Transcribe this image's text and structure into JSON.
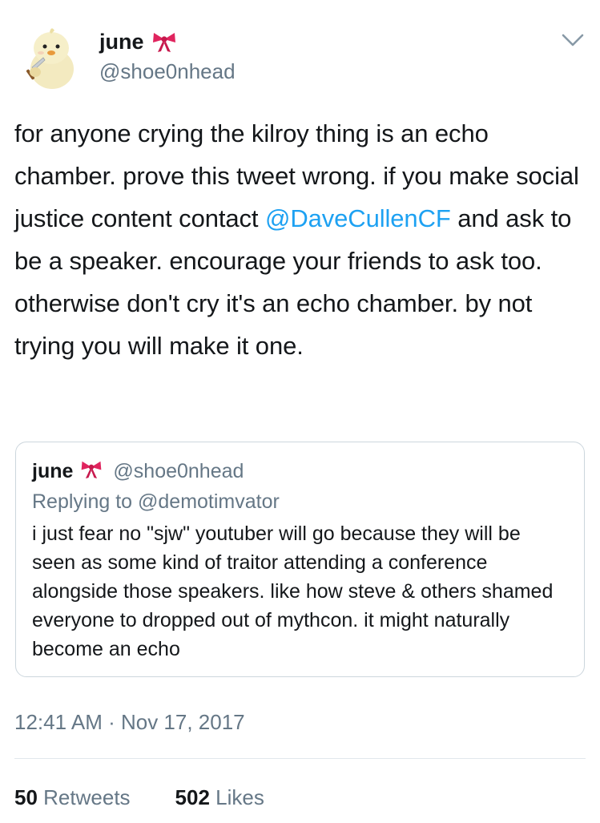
{
  "author": {
    "display_name": "june",
    "handle": "@shoe0nhead",
    "avatar": "duck-chick-with-knife-avatar",
    "name_emoji": "ribbon-bow-icon"
  },
  "tweet": {
    "text_before_mention": "for anyone crying the kilroy thing is an echo chamber. prove this tweet wrong. if you make social justice content contact ",
    "mention": "@DaveCullenCF",
    "text_after_mention": " and ask to be a speaker. encourage your friends to ask too. otherwise don't cry it's an echo chamber. by not trying you will make it one.",
    "timestamp": "12:41 AM · Nov 17, 2017"
  },
  "quoted_tweet": {
    "display_name": "june",
    "handle": "@shoe0nhead",
    "replying_to": "Replying to @demotimvator",
    "text": "i just fear no \"sjw\" youtuber will go because they will be seen as some kind of traitor attending a conference alongside those speakers. like how steve & others shamed everyone to dropped out of mythcon. it might naturally become an echo"
  },
  "stats": {
    "retweets_count": "50",
    "retweets_label": "Retweets",
    "likes_count": "502",
    "likes_label": "Likes"
  },
  "colors": {
    "mention": "#1da1f2",
    "secondary_text": "#657786",
    "primary_text": "#14171a",
    "border": "#ccd6dd",
    "bow": "#e0245e"
  }
}
